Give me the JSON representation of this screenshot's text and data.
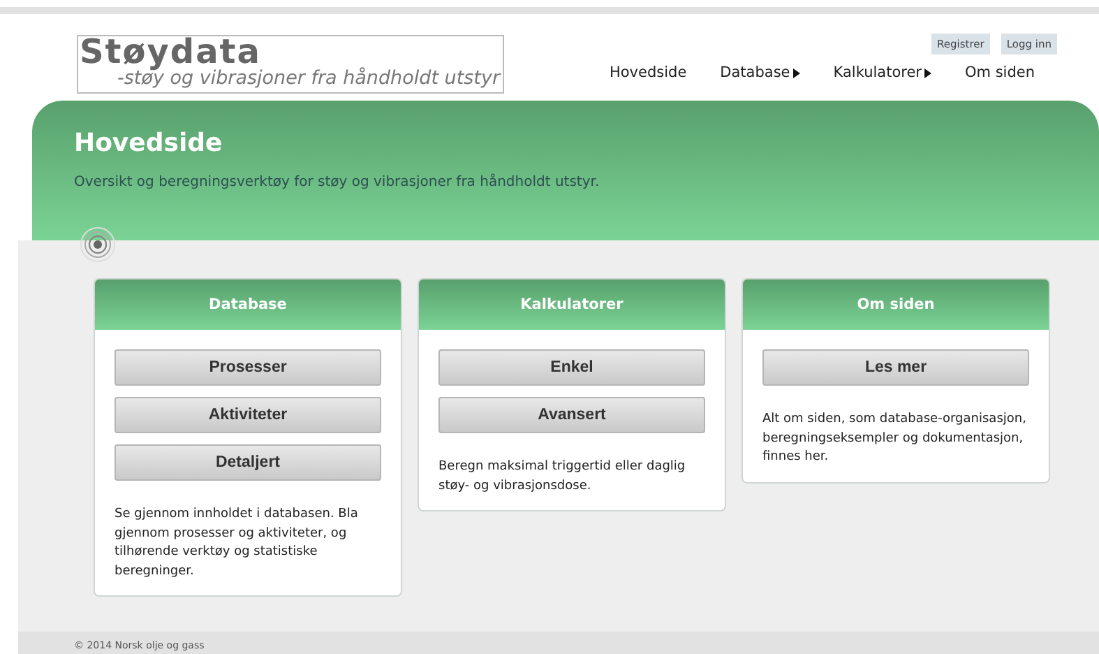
{
  "logo": {
    "title": "Støydata",
    "subtitle": "-støy og vibrasjoner fra håndholdt utstyr"
  },
  "account_links": [
    "Registrer",
    "Logg inn"
  ],
  "nav": [
    {
      "label": "Hovedside",
      "submenu": false
    },
    {
      "label": "Database",
      "submenu": true
    },
    {
      "label": "Kalkulatorer",
      "submenu": true
    },
    {
      "label": "Om siden",
      "submenu": false
    }
  ],
  "hero": {
    "title": "Hovedside",
    "text": "Oversikt og beregningsverktøy for støy og vibrasjoner fra håndholdt utstyr."
  },
  "cards": [
    {
      "title": "Database",
      "buttons": [
        "Prosesser",
        "Aktiviteter",
        "Detaljert"
      ],
      "text": "Se gjennom innholdet i databasen. Bla gjennom prosesser og aktiviteter, og tilhørende verktøy og statistiske beregninger."
    },
    {
      "title": "Kalkulatorer",
      "buttons": [
        "Enkel",
        "Avansert"
      ],
      "text": "Beregn maksimal triggertid eller daglig støy- og vibrasjonsdose."
    },
    {
      "title": "Om siden",
      "buttons": [
        "Les mer"
      ],
      "text": "Alt om siden, som database-organisasjon, beregningseksempler og dokumentasjon, finnes her."
    }
  ],
  "footer": "© 2014 Norsk olje og gass"
}
